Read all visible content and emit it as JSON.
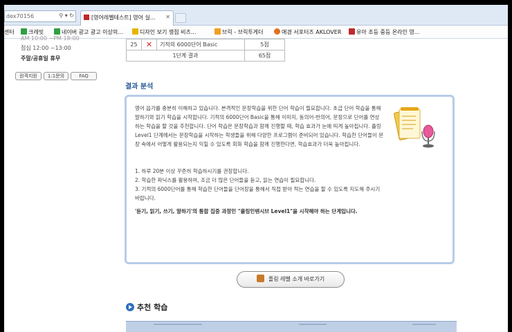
{
  "browser": {
    "address_fragment": "dex70156",
    "tab_title": "[영어레벨테스트] 영어 실...",
    "favorites": [
      {
        "label": "센터",
        "color": ""
      },
      {
        "label": "크레빗",
        "color": "#2ea043"
      },
      {
        "label": "네이버 광고 광고 이상의...",
        "color": "#2ea043"
      },
      {
        "label": "디자인 보기 쟁점 비즈...",
        "color": "#e8b400"
      },
      {
        "label": "브릭 - 브릭투게더",
        "color": "#f0a020"
      },
      {
        "label": "애경 서포터즈 AKLOVER",
        "color": "#e07020"
      },
      {
        "label": "유아 조등 중등 온라인 영...",
        "color": "#c0282d"
      }
    ]
  },
  "sidebar": {
    "hours_partial": "AM 10:00 ~PM 18:00",
    "lunch": "점심 12:00 ~13:00",
    "holiday": "주말/공휴일 휴무",
    "buttons": [
      "원격지원",
      "1:1문의",
      "FAQ"
    ]
  },
  "score_table": {
    "row": {
      "no": "25",
      "result": "wrong",
      "name": "기적의 6000단어 Basic",
      "score": "5점"
    },
    "summary": {
      "label": "1단계 결과",
      "score": "65점"
    }
  },
  "analysis": {
    "title": "결과 분석",
    "paragraph": "영어 읍가를 충분히 이해하고 있습니다. 본격적인 문장학습을 위한 단어 학습이 필요합니다. 초급 단어 학습을 통해 말하기와 읽기 학습을 시작합니다. 기적의 6000단어 Basic을 통해 이미지, 동의어-반의어, 문장으로 단어를 연상하는 학습을 할 것을 추천합니다. 단어 학습은 문장학습과 함께 진행할 때, 학습 효과가 눈에 띄게 높아집니다. 플링 Level1 단계에서는 문장학습을 시작하는 학생들을 위해 다양한 프로그램이 준비되어 있습니다. 학습한 단어들이 문장 속에서 어떻게 활용되는지 익힐 수 있도록 회화 학습을 함께 진행한다면, 학습효과가 더욱 높아집니다.",
    "tips": [
      "1. 하루 20분 이상 꾸준히 학습하시기를 권장합니다.",
      "2. 학습한 파닉스를 활용하여, 조금 더 많은 단어들을 듣고, 읽는 연습이 필요합니다.",
      "3. 기적의 6000단어를 통해 학습한 단어들을 단어장을 통해서 직접 받아 적는 연습을 할 수 있도록 지도해 주시기 바랍니다."
    ],
    "emphasis": "'듣기, 읽기, 쓰기, 말하기'의 통합 집중 과정인 \"플링인텐시브 Level1\"을 시작해야 하는 단계입니다."
  },
  "intro_button": "플링 레벨 소개 바로가기",
  "recommend_title": "추천 학습",
  "colors": {
    "accent": "#2a5c9a",
    "box_border": "#b7cbe8",
    "wrong": "#d42020"
  }
}
